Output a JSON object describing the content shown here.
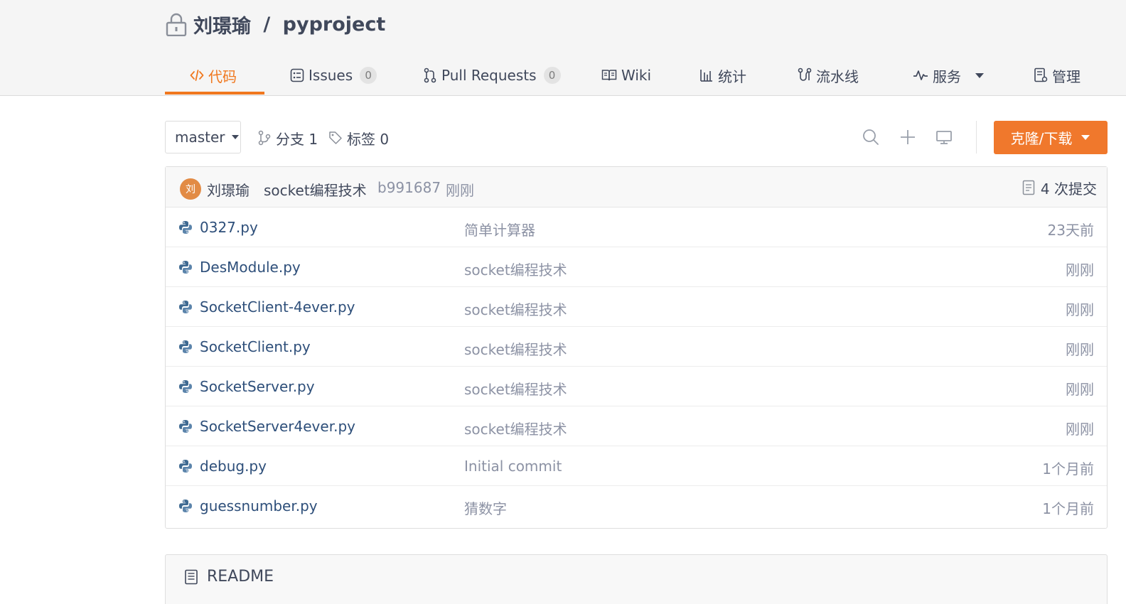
{
  "repo": {
    "owner": "刘璟瑜",
    "separator": " / ",
    "name": "pyproject"
  },
  "tabs": [
    {
      "label": "代码",
      "icon": "code-icon",
      "active": true
    },
    {
      "label": "Issues",
      "icon": "issues-icon",
      "count": "0"
    },
    {
      "label": "Pull Requests",
      "icon": "pull-request-icon",
      "count": "0"
    },
    {
      "label": "Wiki",
      "icon": "wiki-icon"
    },
    {
      "label": "统计",
      "icon": "stats-icon"
    },
    {
      "label": "流水线",
      "icon": "pipeline-icon"
    },
    {
      "label": "服务",
      "icon": "service-icon",
      "dropdown": true
    },
    {
      "label": "管理",
      "icon": "manage-icon"
    }
  ],
  "toolbar": {
    "branch": "master",
    "branches_label": "分支 1",
    "tags_label": "标签 0",
    "clone_label": "克隆/下载"
  },
  "commit": {
    "avatar_text": "刘",
    "author": "刘璟瑜",
    "message": "socket编程技术",
    "hash": "b991687",
    "time": "刚刚",
    "count_label": "4 次提交"
  },
  "files": [
    {
      "name": "0327.py",
      "message": "简单计算器",
      "time": "23天前"
    },
    {
      "name": "DesModule.py",
      "message": "socket编程技术",
      "time": "刚刚"
    },
    {
      "name": "SocketClient-4ever.py",
      "message": "socket编程技术",
      "time": "刚刚"
    },
    {
      "name": "SocketClient.py",
      "message": "socket编程技术",
      "time": "刚刚"
    },
    {
      "name": "SocketServer.py",
      "message": "socket编程技术",
      "time": "刚刚"
    },
    {
      "name": "SocketServer4ever.py",
      "message": "socket编程技术",
      "time": "刚刚"
    },
    {
      "name": "debug.py",
      "message": "Initial commit",
      "time": "1个月前"
    },
    {
      "name": "guessnumber.py",
      "message": "猜数字",
      "time": "1个月前"
    }
  ],
  "readme": {
    "title": "README"
  },
  "colors": {
    "accent": "#f0781f",
    "clone_button": "#f0782c",
    "file_link": "#2e4f7a",
    "muted_text": "#8c92a4",
    "python_icon": "#3f6a92"
  }
}
